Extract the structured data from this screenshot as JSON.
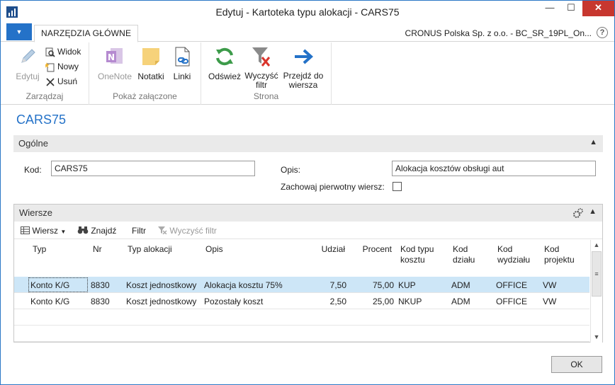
{
  "window": {
    "title": "Edytuj - Kartoteka typu alokacji - CARS75",
    "min_glyph": "—",
    "max_glyph": "☐",
    "close_glyph": "✕"
  },
  "ribbon": {
    "menu_glyph": "▼",
    "tab_main": "NARZĘDZIA GŁÓWNE",
    "company": "CRONUS Polska Sp. z o.o. - BC_SR_19PL_On...",
    "help_glyph": "?",
    "groups": {
      "manage": {
        "label": "Zarządzaj",
        "edit": "Edytuj",
        "view": "Widok",
        "new": "Nowy",
        "delete": "Usuń"
      },
      "attach": {
        "label": "Pokaż załączone",
        "onenote": "OneNote",
        "notes": "Notatki",
        "links": "Linki"
      },
      "page": {
        "label": "Strona",
        "refresh": "Odśwież",
        "clear_filter_1": "Wyczyść",
        "clear_filter_2": "filtr",
        "goto_1": "Przejdź do",
        "goto_2": "wiersza"
      }
    }
  },
  "page_title": "CARS75",
  "general": {
    "section_label": "Ogólne",
    "code_label": "Kod:",
    "code_value": "CARS75",
    "desc_label": "Opis:",
    "desc_value": "Alokacja kosztów obsługi aut",
    "keep_line_label": "Zachowaj pierwotny wiersz:"
  },
  "lines": {
    "section_label": "Wiersze",
    "toolbar": {
      "row": "Wiersz",
      "find": "Znajdź",
      "filter": "Filtr",
      "clear_filter": "Wyczyść filtr"
    },
    "headers": {
      "type": "Typ",
      "no": "Nr",
      "alloc_type": "Typ alokacji",
      "desc": "Opis",
      "share": "Udział",
      "percent": "Procent",
      "cost_type_1": "Kod typu",
      "cost_type_2": "kosztu",
      "dept_1": "Kod",
      "dept_2": "działu",
      "division_1": "Kod",
      "division_2": "wydziału",
      "project_1": "Kod",
      "project_2": "projektu"
    },
    "rows": [
      {
        "type": "Konto K/G",
        "no": "8830",
        "alloc_type": "Koszt jednostkowy",
        "desc": "Alokacja kosztu 75%",
        "share": "7,50",
        "percent": "75,00",
        "cost_type": "KUP",
        "dept": "ADM",
        "division": "OFFICE",
        "project": "VW"
      },
      {
        "type": "Konto K/G",
        "no": "8830",
        "alloc_type": "Koszt jednostkowy",
        "desc": "Pozostały koszt",
        "share": "2,50",
        "percent": "25,00",
        "cost_type": "NKUP",
        "dept": "ADM",
        "division": "OFFICE",
        "project": "VW"
      }
    ]
  },
  "ok_label": "OK"
}
